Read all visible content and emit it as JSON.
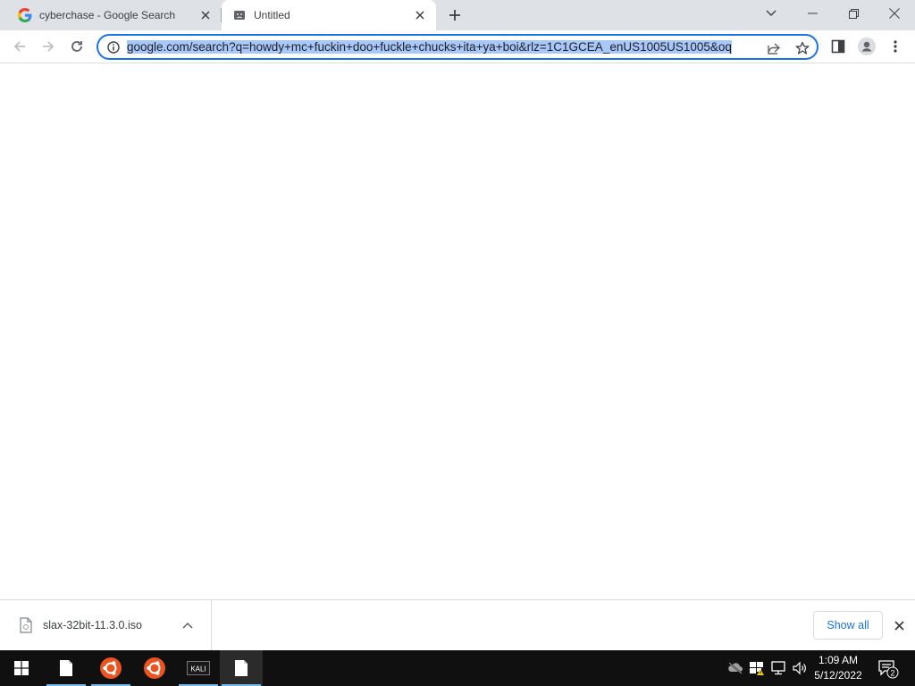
{
  "browser": {
    "tabs": [
      {
        "title": "cyberchase - Google Search",
        "favicon": "google-g-icon"
      },
      {
        "title": "Untitled",
        "favicon": "sad-page-icon",
        "active": true
      }
    ],
    "address_bar": {
      "url": "google.com/search?q=howdy+mc+fuckin+doo+fuckle+chucks+ita+ya+boi&rlz=1C1GCEA_enUS1005US1005&oq",
      "selected": true
    },
    "colors": {
      "accent": "#1a73e8",
      "tabstrip": "#dee1e6",
      "selection": "#a8c7fa"
    }
  },
  "download_shelf": {
    "items": [
      {
        "filename": "slax-32bit-11.3.0.iso",
        "icon": "file-icon"
      }
    ],
    "show_all_label": "Show all"
  },
  "taskbar": {
    "apps": [
      {
        "name": "file-document-icon",
        "active": true
      },
      {
        "name": "ubuntu-icon",
        "active": true
      },
      {
        "name": "ubuntu-icon",
        "active": false
      },
      {
        "name": "kali-icon",
        "label": "KALI",
        "active": true
      },
      {
        "name": "file-document-icon",
        "active": true,
        "focused": true
      }
    ],
    "clock": {
      "time": "1:09 AM",
      "date": "5/12/2022"
    },
    "notification_count": "2"
  }
}
